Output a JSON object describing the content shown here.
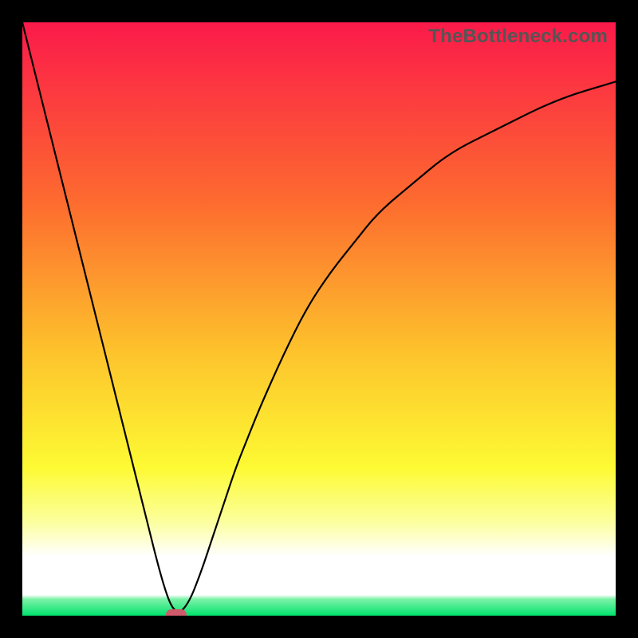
{
  "watermark": "TheBottleneck.com",
  "colors": {
    "black": "#000000",
    "red_top": "#fb1a4a",
    "orange_mid": "#fd8e2b",
    "yellow": "#fdfa33",
    "pale_yellow": "#fcff9b",
    "white": "#ffffff",
    "green_band": "#00e36d",
    "curve": "#000000",
    "marker": "#cf5a6a",
    "watermark_text": "#555555"
  },
  "chart_data": {
    "type": "line",
    "title": "",
    "xlabel": "",
    "ylabel": "",
    "xlim": [
      0,
      100
    ],
    "ylim": [
      0,
      100
    ],
    "series": [
      {
        "name": "bottleneck-curve",
        "x": [
          0,
          5,
          10,
          15,
          20,
          24,
          26,
          28,
          30,
          32,
          34,
          36,
          38,
          40,
          44,
          48,
          52,
          56,
          60,
          66,
          72,
          80,
          90,
          100
        ],
        "y": [
          100,
          80,
          60,
          40,
          20,
          4,
          0,
          2,
          7,
          13,
          19,
          25,
          30,
          35,
          44,
          52,
          58,
          63,
          68,
          73,
          78,
          82,
          87,
          90
        ]
      }
    ],
    "annotations": [
      {
        "name": "min-marker",
        "x": 26,
        "y": 0
      }
    ],
    "gradient_rgb_stops": [
      {
        "pos": 0.0,
        "color": "#fb1a4a"
      },
      {
        "pos": 0.3,
        "color": "#fd6a2f"
      },
      {
        "pos": 0.55,
        "color": "#fdc12c"
      },
      {
        "pos": 0.75,
        "color": "#fdfa33"
      },
      {
        "pos": 0.84,
        "color": "#fcff9b"
      },
      {
        "pos": 0.9,
        "color": "#ffffff"
      },
      {
        "pos": 0.965,
        "color": "#ffffff"
      },
      {
        "pos": 0.972,
        "color": "#7ef2a8"
      },
      {
        "pos": 1.0,
        "color": "#00e36d"
      }
    ]
  }
}
